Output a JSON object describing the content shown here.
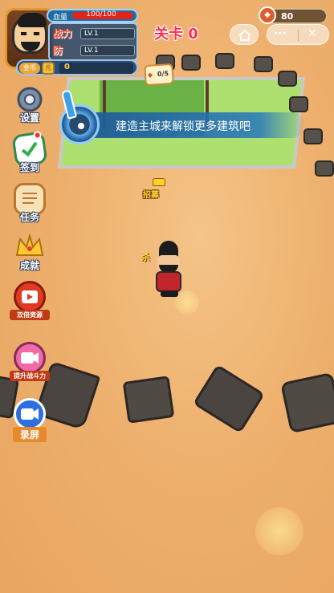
{
  "header": {
    "hp_label": "血量",
    "hp_text": "100/100",
    "hp_fraction": 1.0,
    "power_label": "战力",
    "power_level": "LV.1",
    "defense_label": "防",
    "defense_level": "LV.1",
    "coin_label": "金币",
    "coin_icon": "元",
    "coin_value": "0",
    "level_title": "关卡 0",
    "meat_value": "80"
  },
  "mini_program": {
    "home_icon": "home-icon",
    "more_icon": "···",
    "close_icon": "✕"
  },
  "menu": {
    "settings": "设置",
    "checkin": "签到",
    "tasks": "任务",
    "achievements": "成就",
    "double_resources": "双倍资源",
    "boost_power": "提升战斗力",
    "record": "录屏"
  },
  "banner": {
    "text": "建造主城来解锁更多建筑吧"
  },
  "build_sign": {
    "count": "0/5"
  },
  "npc": {
    "label": "招募"
  },
  "hero": {
    "tag": "杀"
  },
  "colors": {
    "ground": "#eeb06e",
    "grass": "#aee070",
    "level_title": "#ff2d55",
    "banner": "#1e5a96"
  }
}
